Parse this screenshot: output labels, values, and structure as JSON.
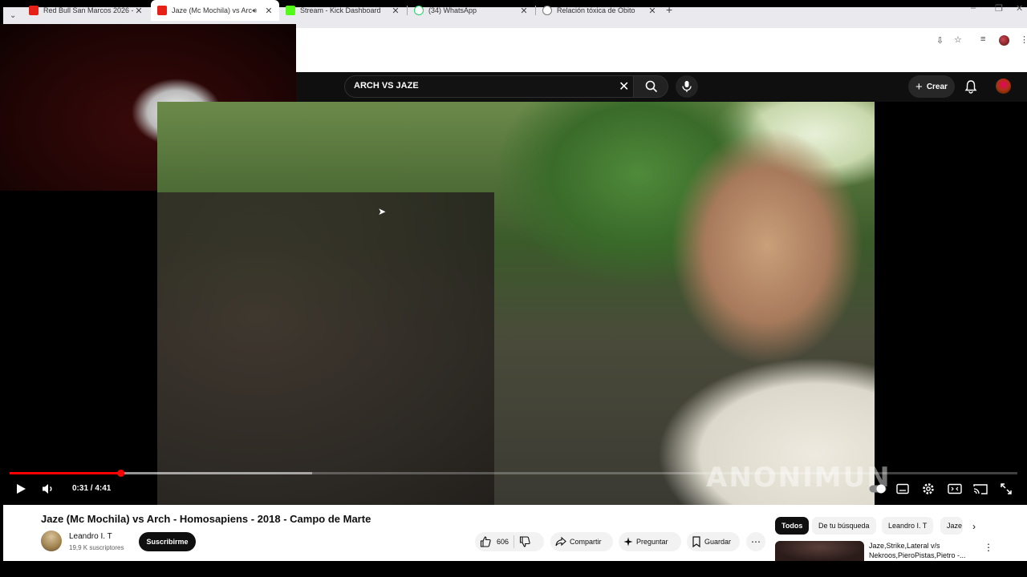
{
  "browser": {
    "tabs": [
      {
        "title": "Red Bull San Marcos 2026 - Yo",
        "favicon": "youtube-icon",
        "active": false
      },
      {
        "title": "Jaze (Mc Mochila) vs Arch",
        "favicon": "youtube-icon",
        "active": true,
        "audio": true
      },
      {
        "title": "Stream - Kick Dashboard",
        "favicon": "kick-icon",
        "active": false
      },
      {
        "title": "(34) WhatsApp",
        "favicon": "whatsapp-icon",
        "active": false
      },
      {
        "title": "Relación tóxica de Obito",
        "favicon": "globe-icon",
        "active": false
      }
    ],
    "new_tab_icon": "+"
  },
  "youtube": {
    "search": {
      "query": "ARCH VS JAZE"
    },
    "header": {
      "create_label": "Crear"
    },
    "player": {
      "time_display": "0:31 / 4:41",
      "progress_fraction": 0.11,
      "buffered_fraction": 0.3,
      "watermark": "ANONIMUN"
    },
    "video": {
      "title": "Jaze (Mc Mochila) vs Arch - Homosapiens - 2018 - Campo de Marte",
      "channel": "Leandro I. T",
      "subscribers": "19,9 K suscriptores",
      "subscribe_label": "Suscribirme",
      "likes": "606",
      "share_label": "Compartir",
      "ask_label": "Preguntar",
      "save_label": "Guardar"
    },
    "chips": [
      "Todos",
      "De tu búsqueda",
      "Leandro I. T",
      "Jaze"
    ],
    "recommendation": {
      "title": "Jaze,Strike,Lateral v/s Nekroos,PieroPistas,Pietro -..."
    }
  },
  "colors": {
    "brand_red": "#ff0000",
    "dark_bg": "#0f0f0f"
  }
}
